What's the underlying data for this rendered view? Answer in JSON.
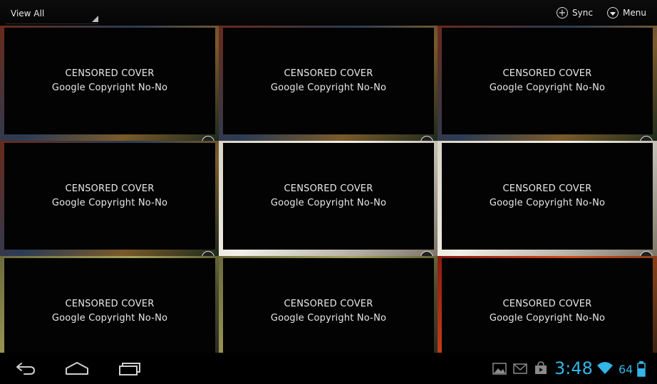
{
  "action_bar": {
    "spinner_label": "View All",
    "sync_label": "Sync",
    "menu_label": "Menu"
  },
  "grid": {
    "tiles": [
      {
        "line1": "CENSORED COVER",
        "line2": "Google Copyright No-No"
      },
      {
        "line1": "CENSORED COVER",
        "line2": "Google Copyright No-No"
      },
      {
        "line1": "CENSORED COVER",
        "line2": "Google Copyright No-No"
      },
      {
        "line1": "CENSORED COVER",
        "line2": "Google Copyright No-No"
      },
      {
        "line1": "CENSORED COVER",
        "line2": "Google Copyright No-No"
      },
      {
        "line1": "CENSORED COVER",
        "line2": "Google Copyright No-No"
      },
      {
        "line1": "CENSORED COVER",
        "line2": "Google Copyright No-No"
      },
      {
        "line1": "CENSORED COVER",
        "line2": "Google Copyright No-No"
      },
      {
        "line1": "CENSORED COVER",
        "line2": "Google Copyright No-No"
      }
    ]
  },
  "system_bar": {
    "time": "3:48",
    "battery": "64",
    "accent_color": "#33b5e5",
    "icons": [
      "back-icon",
      "home-icon",
      "recent-apps-icon",
      "gallery-icon",
      "gmail-icon",
      "market-icon",
      "wifi-icon",
      "battery-icon"
    ]
  }
}
